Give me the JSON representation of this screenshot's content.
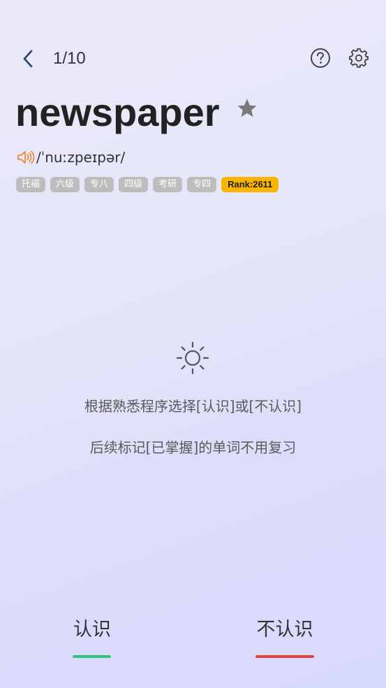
{
  "header": {
    "progress": "1/10",
    "back_icon": "chevron-left-icon",
    "help_icon": "question-circle-icon",
    "settings_icon": "gear-icon"
  },
  "word": {
    "text": "newspaper",
    "phonetic": "/ˈnuːzpeɪpər/",
    "star_icon": "star-icon",
    "speaker_icon": "speaker-icon",
    "speaker_color": "#f08a3c"
  },
  "tags": [
    "托福",
    "六级",
    "专八",
    "四级",
    "考研",
    "专四"
  ],
  "rank": "Rank:2611",
  "hint": {
    "icon": "sun-icon",
    "line1": "根据熟悉程序选择[认识]或[不认识]",
    "line2": "后续标记[已掌握]的单词不用复习"
  },
  "actions": {
    "know_label": "认识",
    "know_color": "#2ec27e",
    "unknown_label": "不认识",
    "unknown_color": "#e0443e"
  }
}
